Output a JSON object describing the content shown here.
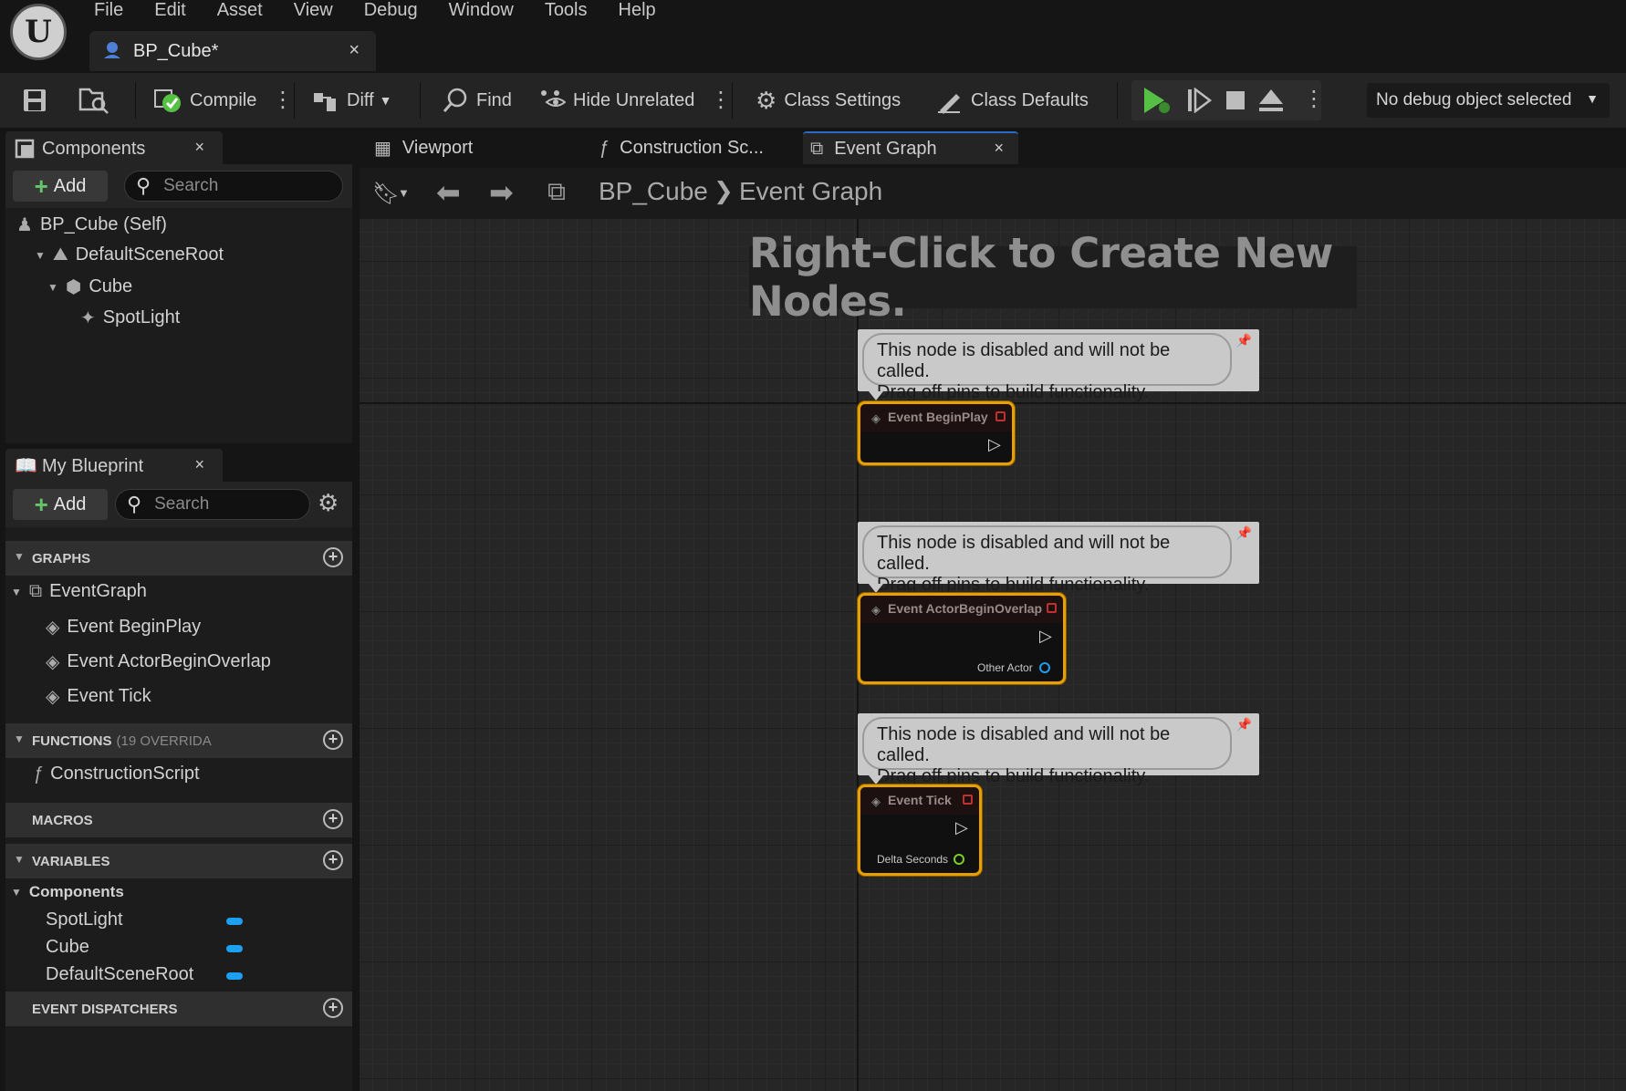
{
  "app": {
    "logo_text": "U"
  },
  "menu": [
    "File",
    "Edit",
    "Asset",
    "View",
    "Debug",
    "Window",
    "Tools",
    "Help"
  ],
  "document_tab": {
    "label": "BP_Cube*",
    "close": "×"
  },
  "toolbar": {
    "compile": "Compile",
    "diff": "Diff",
    "find": "Find",
    "hide_unrelated": "Hide Unrelated",
    "class_settings": "Class Settings",
    "class_defaults": "Class Defaults",
    "debug_object": "No debug object selected"
  },
  "components_panel": {
    "title": "Components",
    "close": "×",
    "add_label": "Add",
    "search_placeholder": "Search",
    "tree": [
      "BP_Cube (Self)",
      "DefaultSceneRoot",
      "Cube",
      "SpotLight"
    ]
  },
  "my_blueprint": {
    "title": "My Blueprint",
    "close": "×",
    "add_label": "Add",
    "search_placeholder": "Search",
    "sections": {
      "graphs": "GRAPHS",
      "functions": "FUNCTIONS",
      "functions_note": "(19 OVERRIDA",
      "macros": "MACROS",
      "variables": "VARIABLES",
      "event_dispatchers": "EVENT DISPATCHERS"
    },
    "graph_items": [
      "EventGraph",
      "Event BeginPlay",
      "Event ActorBeginOverlap",
      "Event Tick"
    ],
    "function_items": [
      "ConstructionScript"
    ],
    "variable_category": "Components",
    "variables": [
      "SpotLight",
      "Cube",
      "DefaultSceneRoot"
    ],
    "variable_color": "#1da0f0"
  },
  "graph_tabs": {
    "viewport": "Viewport",
    "construction": "Construction Sc...",
    "event_graph": "Event Graph",
    "close": "×"
  },
  "breadcrumb": {
    "root": "BP_Cube",
    "current": "Event Graph"
  },
  "graph": {
    "hint": "Right-Click to Create New Nodes.",
    "comment_line1": "This node is disabled and will not be called.",
    "comment_line2": "Drag off pins to build functionality.",
    "nodes": [
      {
        "title": "Event BeginPlay"
      },
      {
        "title": "Event ActorBeginOverlap",
        "pin": "Other Actor"
      },
      {
        "title": "Event Tick",
        "pin": "Delta Seconds"
      }
    ]
  },
  "colors": {
    "accent": "#2a6bc4",
    "node_border": "#e8a000",
    "play_green": "#55c043"
  }
}
